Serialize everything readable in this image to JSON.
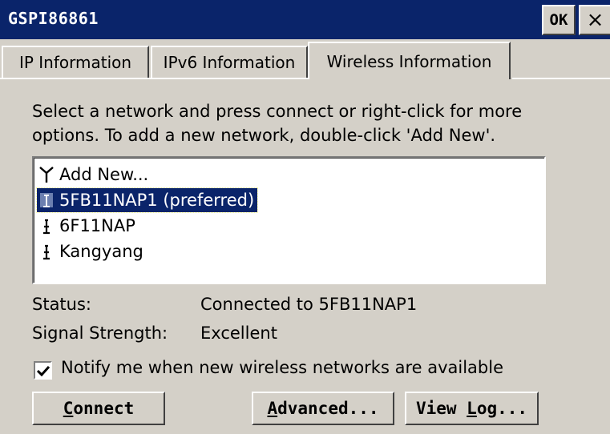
{
  "window": {
    "title": "GSPI86861",
    "ok_label": "OK",
    "close_label": "×"
  },
  "tabs": [
    {
      "label": "IP Information",
      "active": false
    },
    {
      "label": "IPv6 Information",
      "active": false
    },
    {
      "label": "Wireless Information",
      "active": true
    }
  ],
  "wireless": {
    "description": "Select a network and press connect or right-click for more options.  To add a new network, double-click 'Add New'.",
    "networks": [
      {
        "label": "Add New...",
        "icon": "antenna-icon",
        "selected": false
      },
      {
        "label": "5FB11NAP1 (preferred)",
        "icon": "connected-network-icon",
        "selected": true
      },
      {
        "label": "6F11NAP",
        "icon": "network-icon",
        "selected": false
      },
      {
        "label": "Kangyang",
        "icon": "network-icon",
        "selected": false
      }
    ],
    "status_label": "Status:",
    "status_value": "Connected to 5FB11NAP1",
    "signal_label": "Signal Strength:",
    "signal_value": "Excellent",
    "notify_label": "Notify me when new wireless networks are available",
    "notify_checked": true
  },
  "buttons": {
    "connect": {
      "mnemonic": "C",
      "rest": "onnect"
    },
    "advanced": {
      "mnemonic": "A",
      "rest": "dvanced..."
    },
    "view_log": {
      "prefix": "View ",
      "mnemonic": "L",
      "rest": "og..."
    }
  },
  "colors": {
    "titlebar": "#0a246a",
    "face": "#d4d0c8",
    "selection": "#0a246a"
  }
}
